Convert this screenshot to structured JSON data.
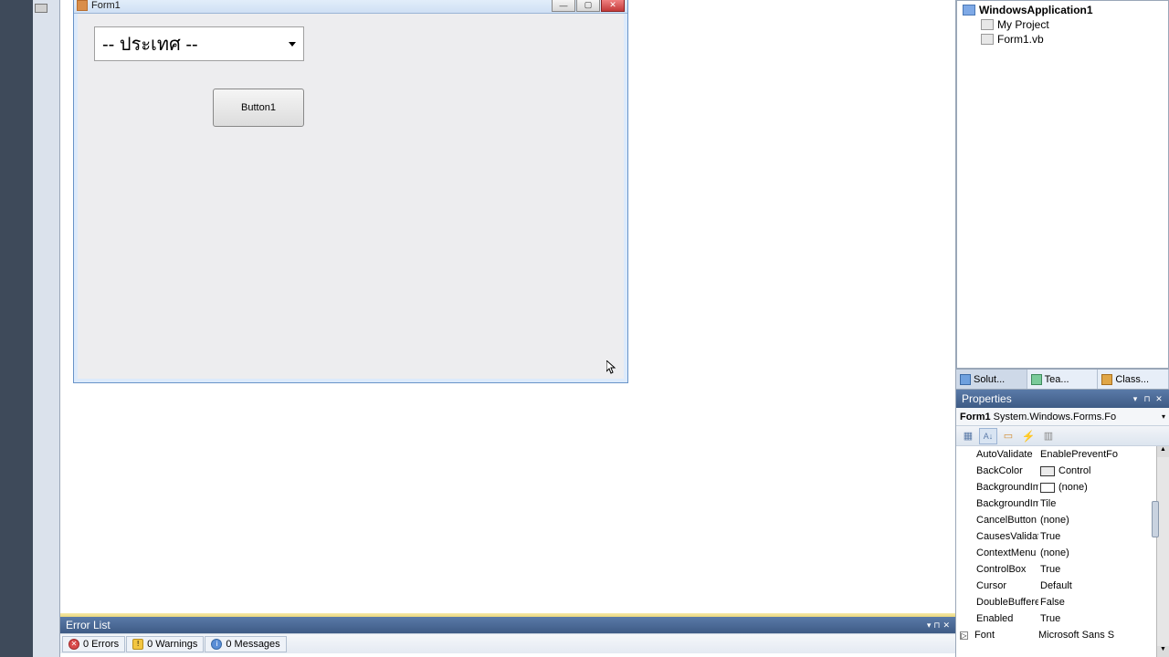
{
  "form": {
    "title": "Form1",
    "combo_text": "-- ประเทศ --",
    "button1_label": "Button1"
  },
  "solution": {
    "project": "WindowsApplication1",
    "items": [
      "My Project",
      "Form1.vb"
    ]
  },
  "panel_tabs": {
    "solution": "Solut...",
    "team": "Tea...",
    "class": "Class..."
  },
  "props": {
    "title": "Properties",
    "object_name": "Form1",
    "object_type": "System.Windows.Forms.Fo",
    "rows": [
      {
        "name": "AutoValidate",
        "value": "EnablePreventFo"
      },
      {
        "name": "BackColor",
        "value": "Control",
        "swatch": "control"
      },
      {
        "name": "BackgroundIm",
        "value": "(none)",
        "swatch": "none"
      },
      {
        "name": "BackgroundIm",
        "value": "Tile"
      },
      {
        "name": "CancelButton",
        "value": "(none)"
      },
      {
        "name": "CausesValidat",
        "value": "True"
      },
      {
        "name": "ContextMenu",
        "value": "(none)"
      },
      {
        "name": "ControlBox",
        "value": "True"
      },
      {
        "name": "Cursor",
        "value": "Default"
      },
      {
        "name": "DoubleBuffere",
        "value": "False"
      },
      {
        "name": "Enabled",
        "value": "True"
      },
      {
        "name": "Font",
        "value": "Microsoft Sans S",
        "expand": true
      }
    ]
  },
  "errorlist": {
    "title": "Error List",
    "errors": "0 Errors",
    "warnings": "0 Warnings",
    "messages": "0 Messages"
  }
}
